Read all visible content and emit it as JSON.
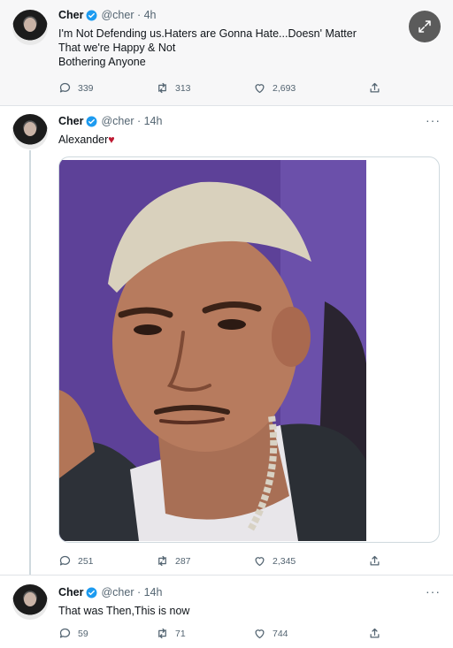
{
  "tweets": [
    {
      "name": "Cher",
      "handle": "@cher · 4h",
      "text_lines": [
        "I'm Not Defending us.Haters are Gonna Hate...Doesn' Matter",
        "That we're Happy & Not",
        "Bothering Anyone"
      ],
      "replies": "339",
      "retweets": "313",
      "likes": "2,693"
    },
    {
      "name": "Cher",
      "handle": "@cher · 14h",
      "text": "Alexander",
      "emoji": "♥",
      "replies": "251",
      "retweets": "287",
      "likes": "2,345"
    },
    {
      "name": "Cher",
      "handle": "@cher · 14h",
      "text": "That was Then,This is now",
      "replies": "59",
      "retweets": "71",
      "likes": "744"
    }
  ],
  "more_menu": "···",
  "colors": {
    "verified": "#1d9bf0",
    "heart_emoji": "#be1931",
    "secondary_text": "#536471",
    "photo_background": "#5b3f95"
  },
  "icons": [
    "reply-icon",
    "retweet-icon",
    "like-icon",
    "share-icon",
    "verified-badge-icon",
    "expand-icon",
    "more-icon"
  ]
}
